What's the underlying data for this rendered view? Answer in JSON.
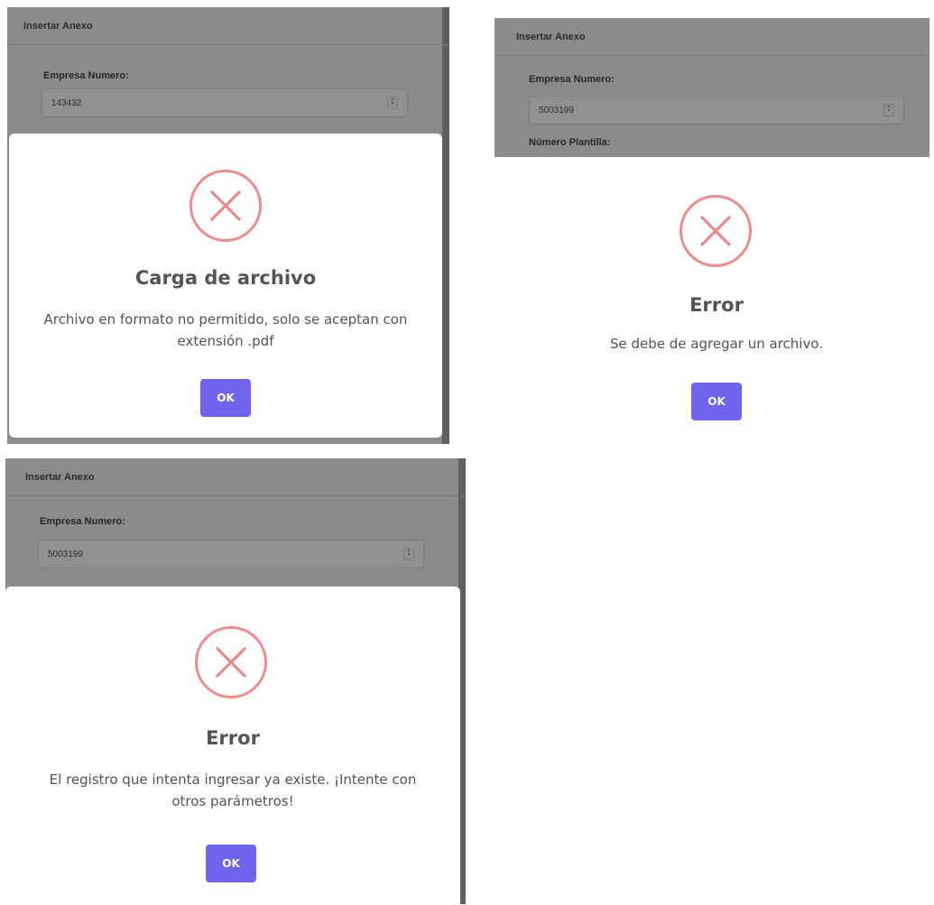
{
  "panel1": {
    "form": {
      "header": "Insertar Anexo",
      "empresa_label": "Empresa Numero:",
      "empresa_value": "143432"
    },
    "dialog": {
      "icon": "error-x-icon",
      "title": "Carga de archivo",
      "message": "Archivo en formato no permitido, solo se aceptan con extensión .pdf",
      "ok_label": "OK"
    }
  },
  "panel2": {
    "form": {
      "header": "Insertar Anexo",
      "empresa_label": "Empresa Numero:",
      "empresa_value": "5003199",
      "plantilla_label": "Número Plantilla:"
    },
    "dialog": {
      "icon": "error-x-icon",
      "title": "Error",
      "message": "Se debe de agregar un archivo.",
      "ok_label": "OK"
    }
  },
  "panel3": {
    "form": {
      "header": "Insertar Anexo",
      "empresa_label": "Empresa Numero:",
      "empresa_value": "5003199"
    },
    "dialog": {
      "icon": "error-x-icon",
      "title": "Error",
      "message": "El registro que intenta ingresar ya existe. ¡Intente con otros parámetros!",
      "ok_label": "OK"
    }
  },
  "colors": {
    "overlay": "#8b8b8b",
    "error_icon": "#f28a89",
    "ok_button": "#7165f0"
  }
}
